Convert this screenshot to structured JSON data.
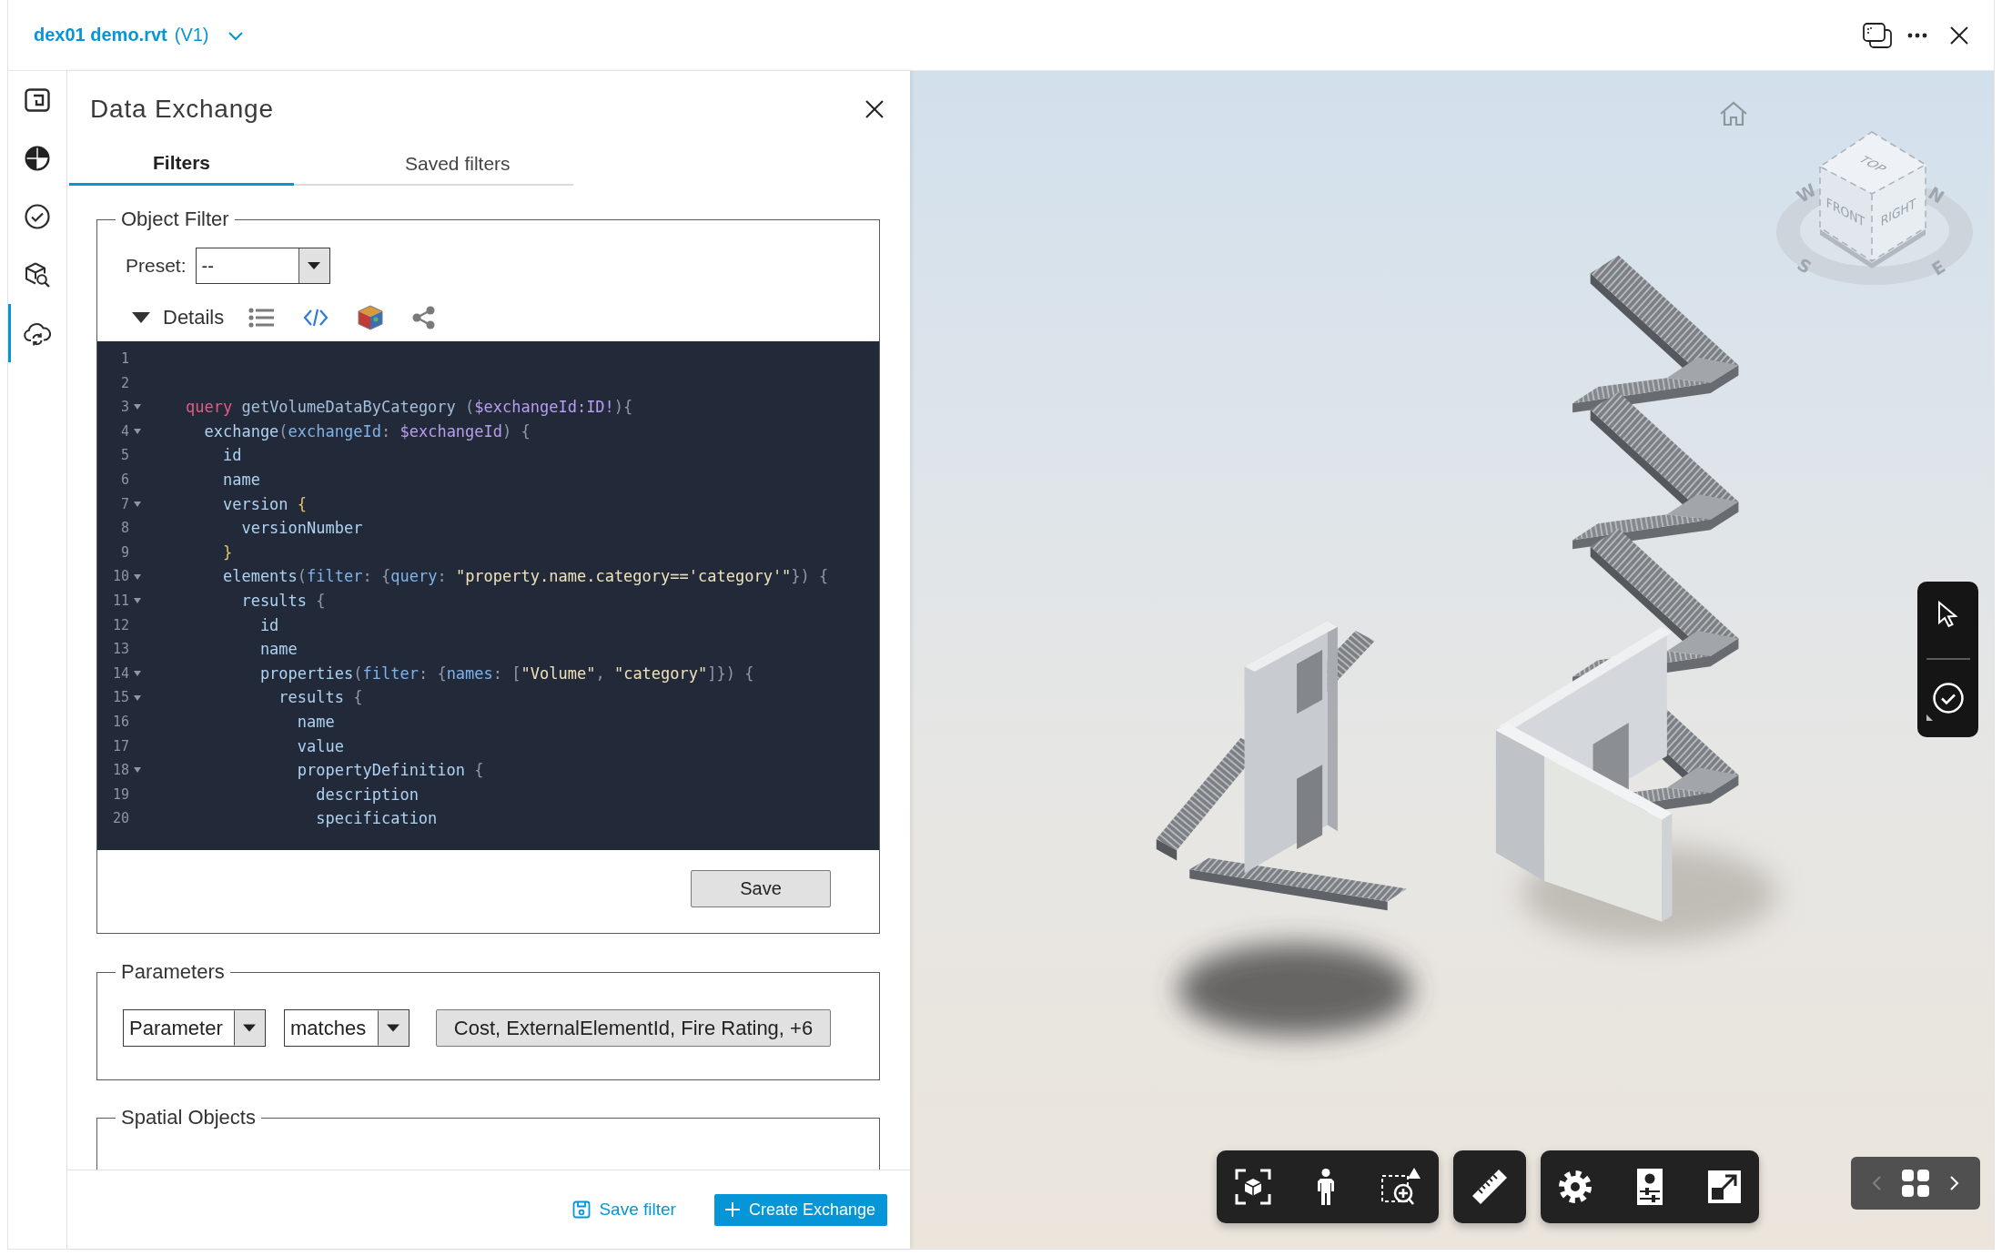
{
  "header": {
    "file_name": "dex01 demo.rvt",
    "version": "(V1)"
  },
  "sidebar": {
    "items": [
      {
        "kind": "sheet",
        "selected": false
      },
      {
        "kind": "pie",
        "selected": false
      },
      {
        "kind": "check",
        "selected": false
      },
      {
        "kind": "cube-search",
        "selected": false
      },
      {
        "kind": "cloud-sync",
        "selected": true
      }
    ]
  },
  "panel": {
    "title": "Data Exchange",
    "tabs": [
      {
        "label": "Filters",
        "selected": true
      },
      {
        "label": "Saved filters",
        "selected": false
      }
    ],
    "object_filter": {
      "legend": "Object Filter",
      "preset": {
        "label": "Preset:",
        "value": "--"
      },
      "details": {
        "label": "Details",
        "expanded": true,
        "tools": [
          {
            "kind": "list",
            "selected": false
          },
          {
            "kind": "code",
            "selected": true
          },
          {
            "kind": "cube",
            "selected": false
          },
          {
            "kind": "share",
            "selected": false
          }
        ]
      },
      "code_lines": [
        {
          "number": "1",
          "foldable": false
        },
        {
          "number": "2",
          "foldable": false
        },
        {
          "number": "3",
          "foldable": true,
          "tokens": [
            {
              "kind": "keyword",
              "text": "query"
            },
            {
              "kind": "def",
              "text": " getVolumeDataByCategory"
            },
            {
              "kind": "punct",
              "text": " ("
            },
            {
              "kind": "variable",
              "text": "$exchangeId:ID!"
            },
            {
              "kind": "punct",
              "text": "){"
            }
          ]
        },
        {
          "number": "4",
          "foldable": true,
          "tokens": [
            {
              "kind": "field",
              "text": "  exchange"
            },
            {
              "kind": "punct",
              "text": "("
            },
            {
              "kind": "attr",
              "text": "exchangeId"
            },
            {
              "kind": "punct",
              "text": ": "
            },
            {
              "kind": "variable",
              "text": "$exchangeId"
            },
            {
              "kind": "punct",
              "text": ") {"
            }
          ]
        },
        {
          "number": "5",
          "foldable": false,
          "tokens": [
            {
              "kind": "field",
              "text": "    id"
            }
          ]
        },
        {
          "number": "6",
          "foldable": false,
          "tokens": [
            {
              "kind": "field",
              "text": "    name"
            }
          ]
        },
        {
          "number": "7",
          "foldable": true,
          "tokens": [
            {
              "kind": "field",
              "text": "    version"
            },
            {
              "kind": "brace",
              "text": " {"
            }
          ]
        },
        {
          "number": "8",
          "foldable": false,
          "tokens": [
            {
              "kind": "field",
              "text": "      versionNumber"
            }
          ]
        },
        {
          "number": "9",
          "foldable": false,
          "tokens": [
            {
              "kind": "brace",
              "text": "    }"
            }
          ]
        },
        {
          "number": "10",
          "foldable": true,
          "tokens": [
            {
              "kind": "field",
              "text": "    elements"
            },
            {
              "kind": "punct",
              "text": "("
            },
            {
              "kind": "attr",
              "text": "filter"
            },
            {
              "kind": "punct",
              "text": ": {"
            },
            {
              "kind": "attr",
              "text": "query"
            },
            {
              "kind": "punct",
              "text": ": "
            },
            {
              "kind": "string",
              "text": "\"property.name.category=='category'\""
            },
            {
              "kind": "punct",
              "text": "}) {"
            }
          ]
        },
        {
          "number": "11",
          "foldable": true,
          "tokens": [
            {
              "kind": "field",
              "text": "      results"
            },
            {
              "kind": "punct",
              "text": " {"
            }
          ]
        },
        {
          "number": "12",
          "foldable": false,
          "tokens": [
            {
              "kind": "field",
              "text": "        id"
            }
          ]
        },
        {
          "number": "13",
          "foldable": false,
          "tokens": [
            {
              "kind": "field",
              "text": "        name"
            }
          ]
        },
        {
          "number": "14",
          "foldable": true,
          "tokens": [
            {
              "kind": "field",
              "text": "        properties"
            },
            {
              "kind": "punct",
              "text": "("
            },
            {
              "kind": "attr",
              "text": "filter"
            },
            {
              "kind": "punct",
              "text": ": {"
            },
            {
              "kind": "attr",
              "text": "names"
            },
            {
              "kind": "punct",
              "text": ": ["
            },
            {
              "kind": "string",
              "text": "\"Volume\""
            },
            {
              "kind": "punct",
              "text": ", "
            },
            {
              "kind": "string",
              "text": "\"category\""
            },
            {
              "kind": "punct",
              "text": "]}) {"
            }
          ]
        },
        {
          "number": "15",
          "foldable": true,
          "tokens": [
            {
              "kind": "field",
              "text": "          results"
            },
            {
              "kind": "punct",
              "text": " {"
            }
          ]
        },
        {
          "number": "16",
          "foldable": false,
          "tokens": [
            {
              "kind": "field",
              "text": "            name"
            }
          ]
        },
        {
          "number": "17",
          "foldable": false,
          "tokens": [
            {
              "kind": "field",
              "text": "            value"
            }
          ]
        },
        {
          "number": "18",
          "foldable": true,
          "tokens": [
            {
              "kind": "field",
              "text": "            propertyDefinition"
            },
            {
              "kind": "punct",
              "text": " {"
            }
          ]
        },
        {
          "number": "19",
          "foldable": false,
          "tokens": [
            {
              "kind": "field",
              "text": "              description"
            }
          ]
        },
        {
          "number": "20",
          "foldable": false,
          "tokens": [
            {
              "kind": "field",
              "text": "              specification"
            }
          ]
        }
      ],
      "save_button": "Save"
    },
    "parameters": {
      "legend": "Parameters",
      "field": "Parameter",
      "operator": "matches",
      "values": "Cost, ExternalElementId, Fire Rating, +6"
    },
    "spatial_objects": {
      "legend": "Spatial Objects"
    },
    "actions": {
      "save_filter": "Save filter",
      "create": "Create Exchange"
    }
  },
  "viewer": {
    "view_cube": {
      "faces": [
        "TOP",
        "FRONT",
        "RIGHT"
      ],
      "compass": [
        "W",
        "N",
        "S",
        "E"
      ]
    },
    "palette": [
      {
        "kind": "select"
      },
      {
        "kind": "markup"
      }
    ],
    "toolbar": [
      {
        "tools": [
          {
            "kind": "fit"
          },
          {
            "kind": "walk"
          },
          {
            "kind": "zoom-window"
          }
        ]
      },
      {
        "tools": [
          {
            "kind": "measure"
          }
        ]
      },
      {
        "tools": [
          {
            "kind": "settings"
          },
          {
            "kind": "properties"
          },
          {
            "kind": "fullscreen"
          }
        ]
      }
    ],
    "navigator": {
      "previous": {
        "disabled": true
      },
      "next": {
        "disabled": false
      }
    }
  }
}
